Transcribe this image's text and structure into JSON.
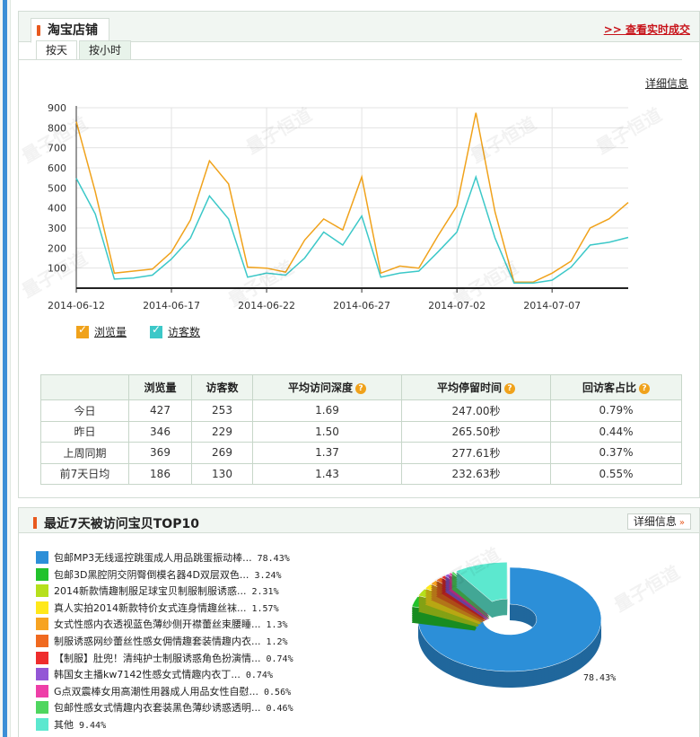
{
  "panel1": {
    "title": "淘宝店铺",
    "live_link": ">> 查看实时成交",
    "tabs": [
      "按天",
      "按小时"
    ],
    "detail_link": "详细信息"
  },
  "chart_data": {
    "type": "line",
    "x": [
      "2014-06-12",
      "2014-06-13",
      "2014-06-14",
      "2014-06-15",
      "2014-06-16",
      "2014-06-17",
      "2014-06-18",
      "2014-06-19",
      "2014-06-20",
      "2014-06-21",
      "2014-06-22",
      "2014-06-23",
      "2014-06-24",
      "2014-06-25",
      "2014-06-26",
      "2014-06-27",
      "2014-06-28",
      "2014-06-29",
      "2014-06-30",
      "2014-07-01",
      "2014-07-02",
      "2014-07-03",
      "2014-07-04",
      "2014-07-05",
      "2014-07-06",
      "2014-07-07",
      "2014-07-08",
      "2014-07-09",
      "2014-07-10",
      "2014-07-11"
    ],
    "x_tick_labels": [
      "2014-06-12",
      "2014-06-17",
      "2014-06-22",
      "2014-06-27",
      "2014-07-02",
      "2014-07-07"
    ],
    "y_ticks": [
      100,
      200,
      300,
      400,
      500,
      600,
      700,
      800,
      900
    ],
    "ylim": [
      0,
      900
    ],
    "series": [
      {
        "name": "浏览量",
        "color": "#f0a21b",
        "values": [
          830,
          480,
          75,
          85,
          95,
          180,
          340,
          635,
          520,
          105,
          100,
          80,
          240,
          345,
          290,
          555,
          75,
          110,
          100,
          260,
          410,
          875,
          380,
          30,
          30,
          75,
          135,
          300,
          346,
          427
        ]
      },
      {
        "name": "访客数",
        "color": "#3cc8c8",
        "values": [
          548,
          370,
          45,
          50,
          65,
          145,
          250,
          460,
          345,
          55,
          75,
          65,
          150,
          280,
          215,
          360,
          55,
          75,
          85,
          180,
          280,
          555,
          250,
          25,
          25,
          40,
          105,
          215,
          229,
          253
        ]
      }
    ]
  },
  "table": {
    "headers": [
      "",
      "浏览量",
      "访客数",
      "平均访问深度",
      "平均停留时间",
      "回访客占比"
    ],
    "rows": [
      [
        "今日",
        "427",
        "253",
        "1.69",
        "247.00秒",
        "0.79%"
      ],
      [
        "昨日",
        "346",
        "229",
        "1.50",
        "265.50秒",
        "0.44%"
      ],
      [
        "上周同期",
        "369",
        "269",
        "1.37",
        "277.61秒",
        "0.37%"
      ],
      [
        "前7天日均",
        "186",
        "130",
        "1.43",
        "232.63秒",
        "0.55%"
      ]
    ],
    "help_icon": "?"
  },
  "panel2": {
    "title": "最近7天被访问宝贝TOP10",
    "detail_button": "详细信息",
    "detail_arrow": "»",
    "items": [
      {
        "label": "包邮MP3无线遥控跳蛋成人用品跳蛋振动棒...",
        "pct": "78.43%",
        "value": 78.43,
        "color": "#2c8fd8"
      },
      {
        "label": "包邮3D黑腔阴交阴臀倒模名器4D双层双色...",
        "pct": "3.24%",
        "value": 3.24,
        "color": "#22c22c"
      },
      {
        "label": "2014新款情趣制服足球宝贝制服制服诱惑...",
        "pct": "2.31%",
        "value": 2.31,
        "color": "#b6e01c"
      },
      {
        "label": "真人实拍2014新款特价女式连身情趣丝袜...",
        "pct": "1.57%",
        "value": 1.57,
        "color": "#ffe81a"
      },
      {
        "label": "女式性感内衣透视蓝色薄纱侧开襟蕾丝束腰睡...",
        "pct": "1.3%",
        "value": 1.3,
        "color": "#f7a321"
      },
      {
        "label": "制服诱惑网纱蕾丝性感女佣情趣套装情趣内衣...",
        "pct": "1.2%",
        "value": 1.2,
        "color": "#f06a20"
      },
      {
        "label": "【制服】肚兜！清纯护士制服诱惑角色扮演情...",
        "pct": "0.74%",
        "value": 0.74,
        "color": "#ee2d2d"
      },
      {
        "label": "韩国女主播kw7142性感女式情趣内衣丁...",
        "pct": "0.74%",
        "value": 0.74,
        "color": "#9357d6"
      },
      {
        "label": "G点双震棒女用高潮性用器成人用品女性自慰...",
        "pct": "0.56%",
        "value": 0.56,
        "color": "#ee3fa8"
      },
      {
        "label": "包邮性感女式情趣内衣套装黑色薄纱诱惑透明...",
        "pct": "0.46%",
        "value": 0.46,
        "color": "#4fd65f"
      },
      {
        "label": "其他",
        "pct": "9.44%",
        "value": 9.44,
        "color": "#5ce8cf"
      }
    ],
    "pie_label": "78.43%"
  },
  "watermark": "量子恒道"
}
